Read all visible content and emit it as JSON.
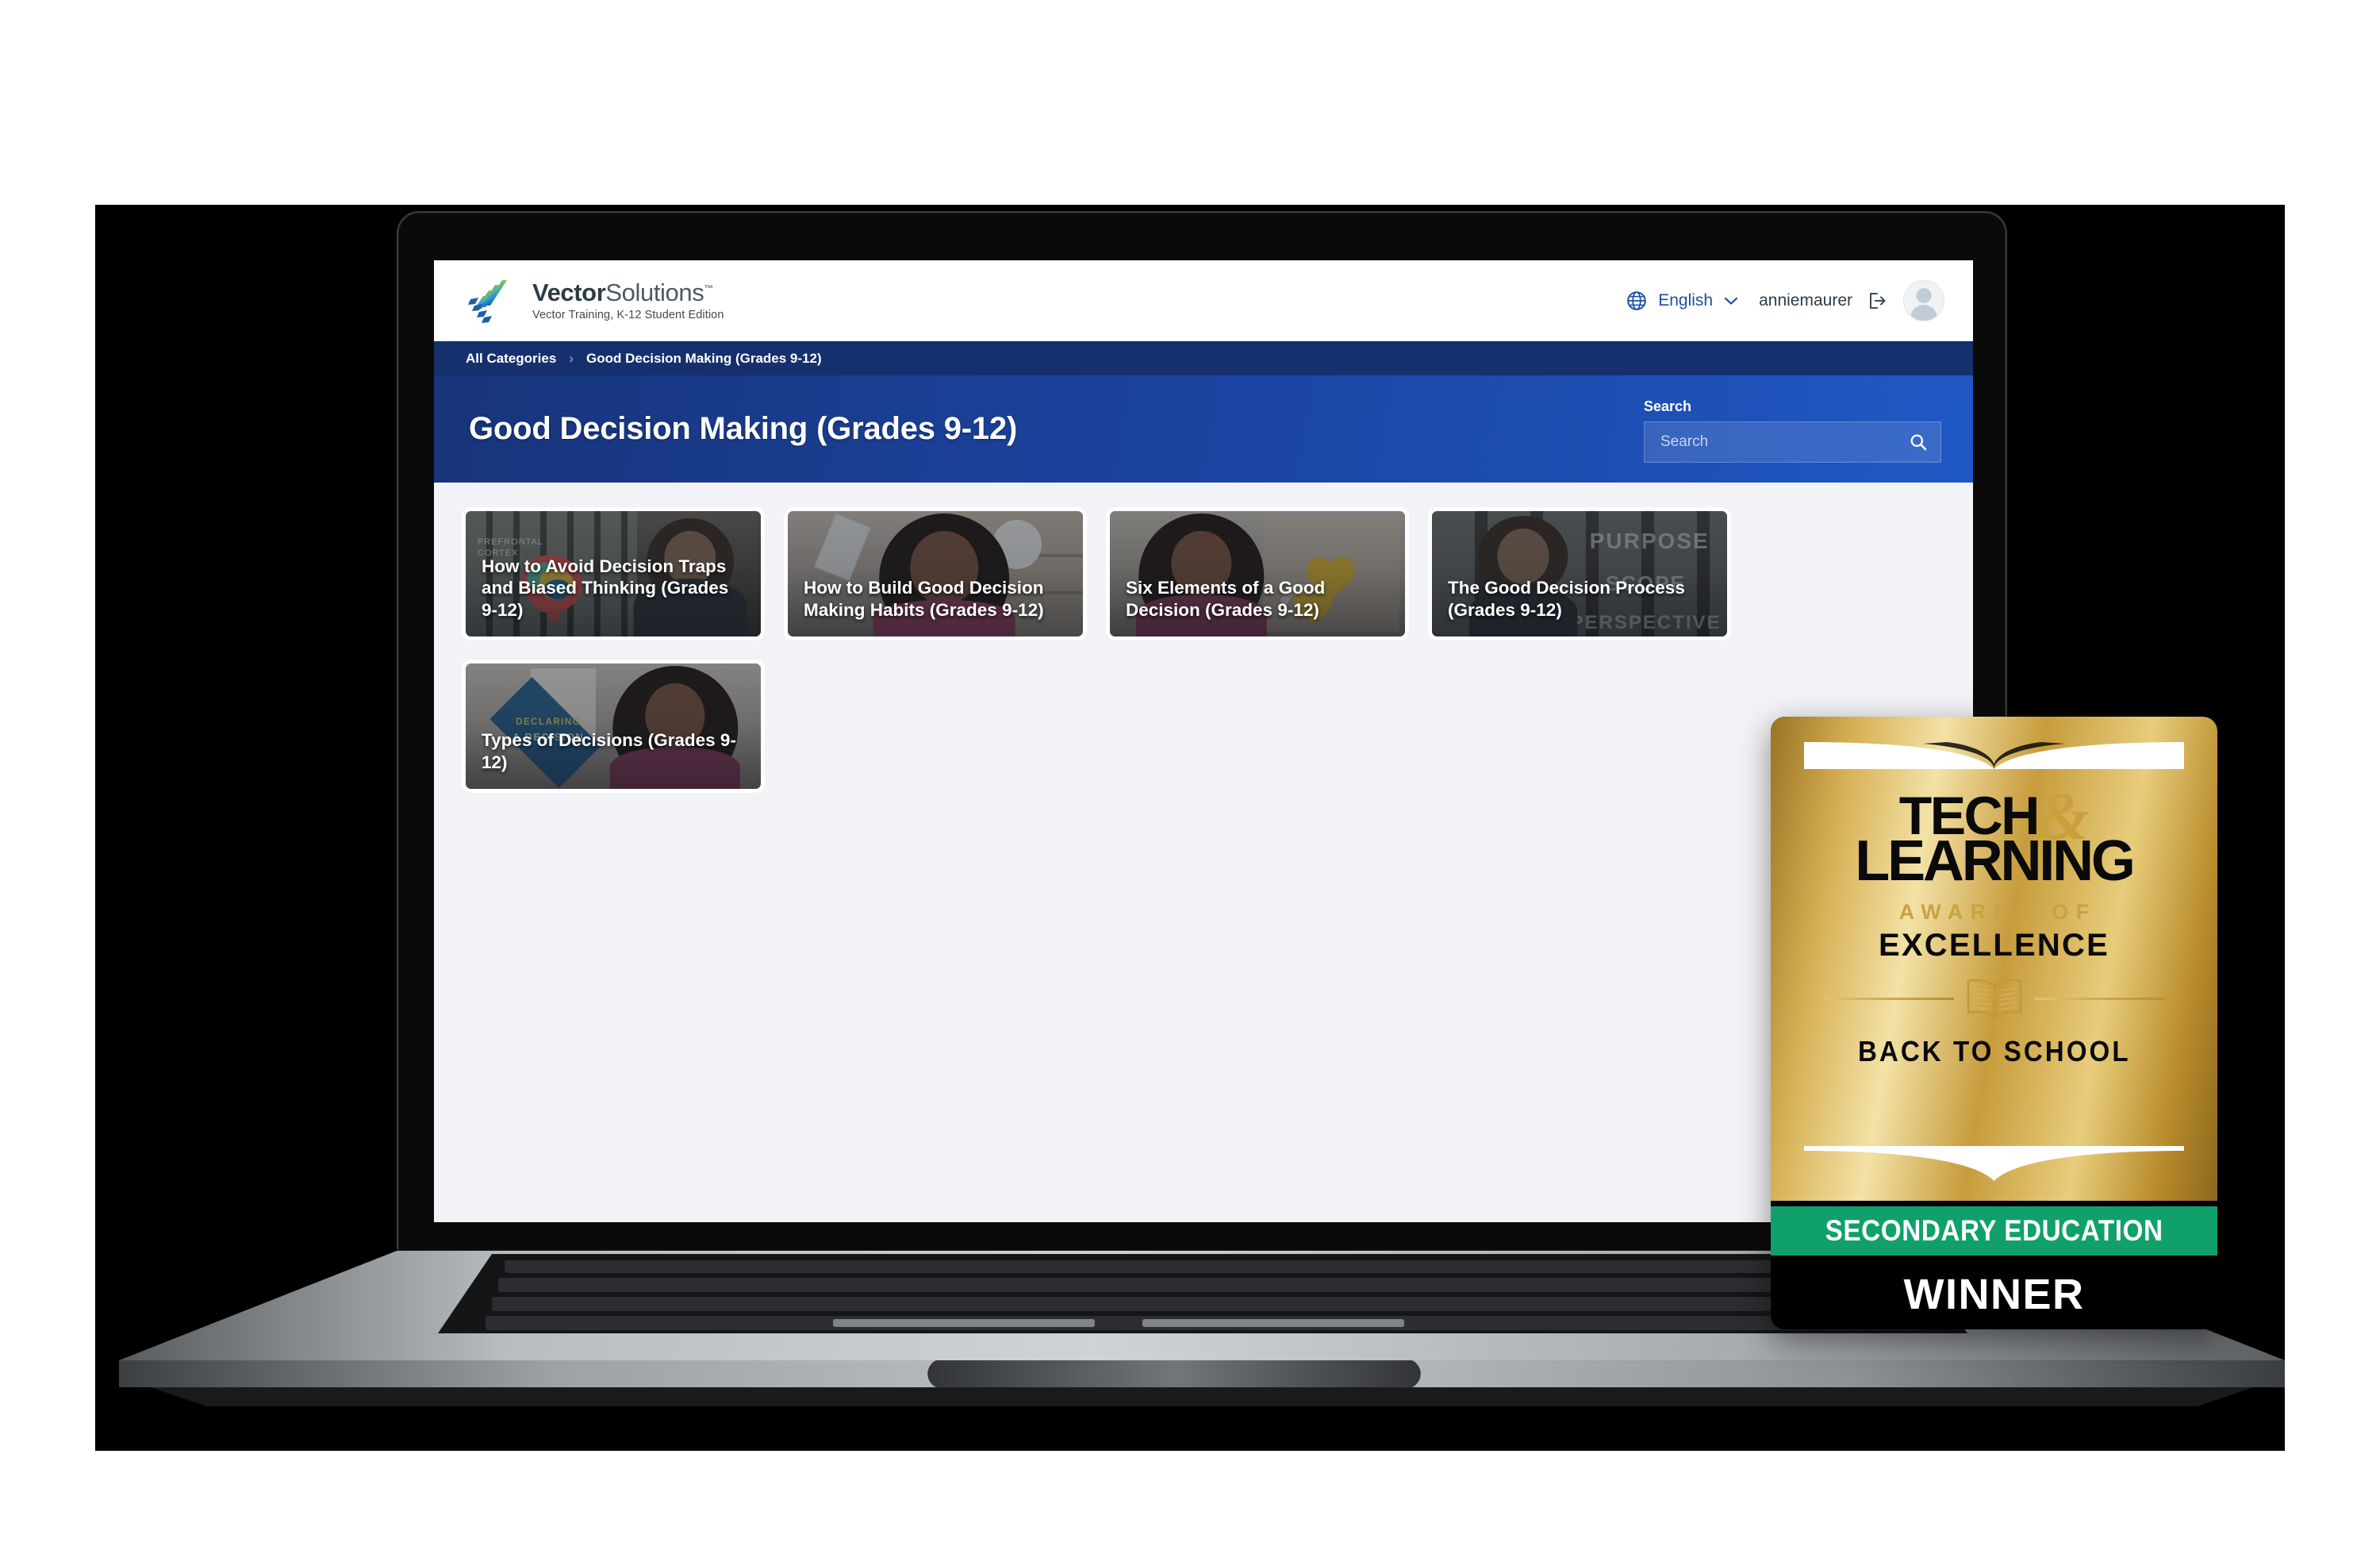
{
  "site": {
    "brand": {
      "name_bold": "Vector",
      "name_light": "Solutions",
      "trademark": "™",
      "tagline": "Vector Training, K-12 Student Edition",
      "logo_icon": "vector-chevron-logo"
    },
    "header": {
      "globe_icon": "globe-icon",
      "language": "English",
      "chevron_icon": "chevron-down-icon",
      "username": "anniemaurer",
      "logout_icon": "logout-icon",
      "avatar_icon": "user-avatar-placeholder"
    },
    "breadcrumb": {
      "root": "All Categories",
      "separator": "›",
      "current": "Good Decision Making (Grades 9-12)"
    },
    "hero": {
      "title": "Good Decision Making (Grades 9-12)",
      "search_label": "Search",
      "search_placeholder": "Search",
      "search_value": "",
      "search_icon": "search-icon"
    },
    "colors": {
      "breadcrumb_bar": "#16306e",
      "hero_start": "#18347a",
      "hero_end": "#2058c4",
      "page_bg": "#f1f3f6",
      "link_blue": "#1c4fa1"
    }
  },
  "courses": [
    {
      "title": "How to Avoid Decision Traps and Biased Thinking (Grades 9-12)",
      "thumbnail_alt": "Brain diagram poster labeled PREFRONTAL CORTEX with a teen student",
      "thumbnail_overlay_text": "PREFRONTAL\nCORTEX"
    },
    {
      "title": "How to Build Good Decision Making Habits (Grades 9-12)",
      "thumbnail_alt": "Student speaking in a classroom with anatomy posters, ruler and globe doodle"
    },
    {
      "title": "Six Elements of a Good Decision (Grades 9-12)",
      "thumbnail_alt": "Student speaking with yellow heart graphics on the right"
    },
    {
      "title": "The Good Decision Process (Grades 9-12)",
      "thumbnail_alt": "Teen student in front of glass doors with words written on them",
      "glass_words": [
        "PURPOSE",
        "SCOPE",
        "PERSPECTIVE"
      ]
    },
    {
      "title": "Types of Decisions (Grades 9-12)",
      "thumbnail_alt": "Student speaking with a blue diamond graphic",
      "diamond_text_top": "DECLARING",
      "diamond_text_bottom": "A DECISION"
    }
  ],
  "award_badge": {
    "line1": "TECH",
    "ampersand": "&",
    "line2": "LEARNING",
    "awards_of": "AWARDS OF",
    "excellence": "EXCELLENCE",
    "book_icon": "open-book-icon",
    "category": "BACK TO SCHOOL",
    "segment": "SECONDARY EDUCATION",
    "result": "WINNER",
    "colors": {
      "gold": "#c79c3c",
      "green": "#10a06c",
      "black": "#000000"
    }
  },
  "device": {
    "type": "laptop-mockup",
    "lid_color": "#0a0a0a",
    "base_color": "#9aa0a5"
  }
}
